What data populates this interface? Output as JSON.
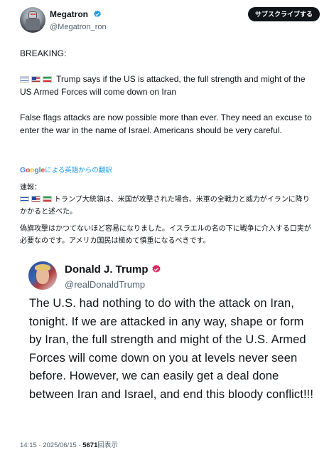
{
  "author": {
    "display_name": "Megatron",
    "handle": "@Megatron_ron",
    "avatar_icon": "robot-avatar-icon",
    "verified_icon": "verified-badge-icon"
  },
  "subscribe_label": "サブスクライブする",
  "post": {
    "breaking": "BREAKING:",
    "line1_flags": [
      "israel-flag-icon",
      "us-flag-icon",
      "iran-flag-icon"
    ],
    "line1": "Trump says if the US is attacked, the full strength and might of the US Armed Forces will come down on Iran",
    "line2": "False flags attacks are now possible more than ever. They need an excuse to enter the war in the name of Israel. Americans should be very careful."
  },
  "translation": {
    "provider": "Google",
    "label": "による英語からの翻訳",
    "heading": "速報：",
    "line1": "トランプ大統領は、米国が攻撃された場合、米軍の全戦力と威力がイランに降りかかると述べた。",
    "line2": "偽旗攻撃はかつてないほど容易になりました。イスラエルの名の下に戦争に介入する口実が必要なのです。アメリカ国民は極めて慎重になるべきです。"
  },
  "embedded": {
    "display_name": "Donald J. Trump",
    "handle": "@realDonaldTrump",
    "text": "The U.S. had nothing to do with the attack on Iran, tonight. If we are attacked in any way, shape or form by Iran, the full strength and might of the U.S. Armed Forces will come down on you at levels never seen before. However, we can easily get a deal done between Iran and Israel, and end this bloody conflict!!!"
  },
  "meta": {
    "time_date": "14:15 · 2025/06/15 · ",
    "views_count": "5671",
    "views_label": "回表示"
  },
  "colors": {
    "link": "#1d9bf0",
    "verified": "#1d9bf0",
    "verified_embedded": "#e0245e"
  }
}
